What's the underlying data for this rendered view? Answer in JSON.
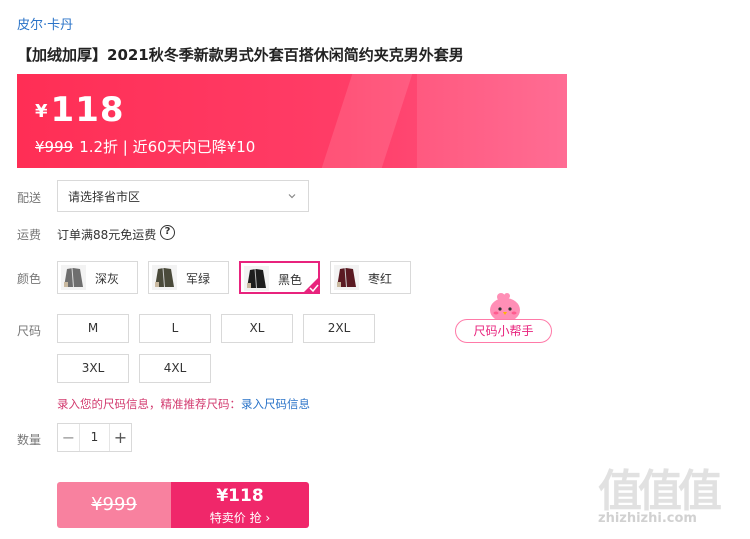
{
  "brand": "皮尔·卡丹",
  "product_title": "【加绒加厚】2021秋冬季新款男式外套百搭休闲简约夹克男外套男",
  "price": {
    "currency": "¥",
    "current": "118",
    "original": "¥999",
    "detail": "1.2折 | 近60天内已降¥10",
    "banner_color": "#ff2e55"
  },
  "delivery": {
    "label": "配送",
    "placeholder": "请选择省市区"
  },
  "shipping": {
    "label": "运费",
    "text": "订单满88元免运费",
    "help_icon": "?"
  },
  "colors": {
    "label": "颜色",
    "options": [
      {
        "name": "深灰",
        "swatch": "#6e6e6e",
        "selected": false
      },
      {
        "name": "军绿",
        "swatch": "#4a4a3a",
        "selected": false
      },
      {
        "name": "黑色",
        "swatch": "#1e1e1e",
        "selected": true
      },
      {
        "name": "枣红",
        "swatch": "#5a1a22",
        "selected": false
      }
    ],
    "selected_color": "#e8237d"
  },
  "sizes": {
    "label": "尺码",
    "options": [
      "M",
      "L",
      "XL",
      "2XL",
      "3XL",
      "4XL"
    ],
    "helper": "尺码小帮手",
    "tip_text": "录入您的尺码信息，精准推荐尺码：",
    "tip_link": "录入尺码信息"
  },
  "quantity": {
    "label": "数量",
    "value": "1",
    "minus": "−",
    "plus": "+"
  },
  "buy": {
    "original_price": "¥999",
    "special_price": "¥118",
    "action_label": "特卖价 抢 ›"
  },
  "watermark": {
    "glyphs": "值值值",
    "domain": "zhizhizhi.com"
  }
}
